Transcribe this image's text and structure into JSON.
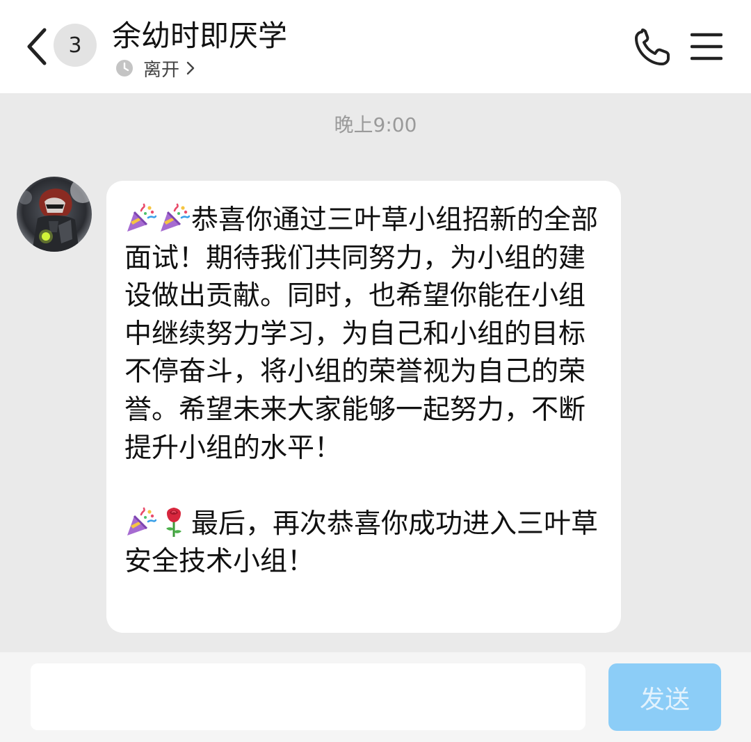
{
  "header": {
    "back_icon": "chevron-left-icon",
    "unread_count": "3",
    "title": "余幼时即厌学",
    "status": "离开",
    "status_icon": "clock-icon",
    "status_chevron_icon": "chevron-right-icon",
    "call_icon": "phone-icon",
    "menu_icon": "menu-icon"
  },
  "conversation": {
    "timestamp": "晚上9:00",
    "message": {
      "sender_avatar": "avatar",
      "paragraph1_emojis": [
        "party-popper-emoji",
        "party-popper-emoji"
      ],
      "paragraph1": "恭喜你通过三叶草小组招新的全部面试！期待我们共同努力，为小组的建设做出贡献。同时，也希望你能在小组中继续努力学习，为自己和小组的目标不停奋斗，将小组的荣誉视为自己的荣誉。希望未来大家能够一起努力，不断提升小组的水平！",
      "paragraph2_emojis": [
        "party-popper-emoji",
        "rose-emoji"
      ],
      "paragraph2": "最后，再次恭喜你成功进入三叶草安全技术小组！"
    }
  },
  "composer": {
    "input_value": "",
    "send_label": "发送"
  },
  "colors": {
    "background": "#eaeaea",
    "header_bg": "#ffffff",
    "bubble_bg": "#ffffff",
    "send_button_bg": "#8ccdf7",
    "send_button_text": "#e2f2fd",
    "timestamp_text": "#9a9a9a"
  }
}
